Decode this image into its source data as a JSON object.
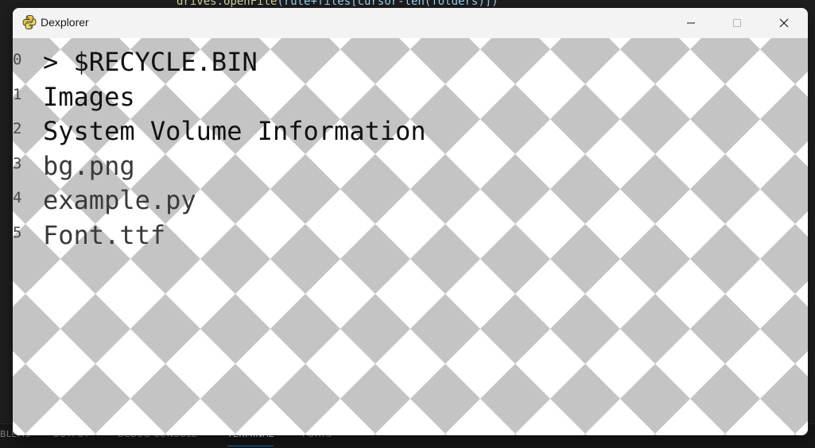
{
  "background": {
    "code_fragment": {
      "part1": "drives",
      "part2": ".",
      "part3": "openFile",
      "part4": "(rute+files[cursor-len(folders)])"
    },
    "panel_tabs": [
      {
        "label": "BLEMS"
      },
      {
        "label": "OUTPUT"
      },
      {
        "label": "DEBUG CONSOLE"
      },
      {
        "label": "TERMINAL",
        "active": true
      },
      {
        "label": "PORTS"
      }
    ]
  },
  "window": {
    "title": "Dexplorer",
    "icon": "python-icon",
    "controls": [
      "minimize-icon",
      "maximize-icon",
      "close-icon"
    ]
  },
  "explorer": {
    "cursor_marker": ">",
    "selected_index": 0,
    "entries": [
      {
        "index": "0",
        "name": "$RECYCLE.BIN",
        "kind": "folder"
      },
      {
        "index": "1",
        "name": "Images",
        "kind": "folder"
      },
      {
        "index": "2",
        "name": "System Volume Information",
        "kind": "folder"
      },
      {
        "index": "3",
        "name": "bg.png",
        "kind": "file"
      },
      {
        "index": "4",
        "name": "example.py",
        "kind": "file"
      },
      {
        "index": "5",
        "name": "Font.ttf",
        "kind": "file"
      }
    ]
  },
  "colors": {
    "checker_gray": "#c4c4c4",
    "checker_white": "#ffffff",
    "titlebar": "#f3f3f3",
    "terminal_accent": "#0078d4"
  }
}
